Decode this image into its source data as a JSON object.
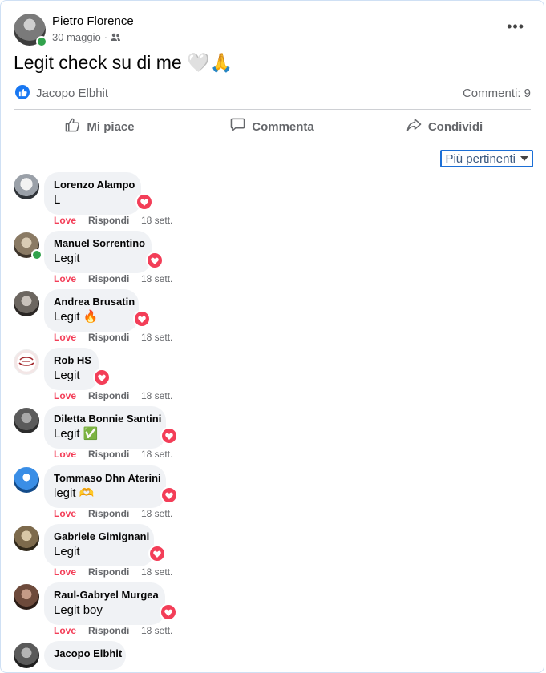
{
  "post": {
    "author": "Pietro Florence",
    "date": "30 maggio",
    "text": "Legit check su di me 🤍🙏",
    "reactor": "Jacopo Elbhit",
    "comment_count": "Commenti: 9"
  },
  "actions": {
    "like": "Mi piace",
    "comment": "Commenta",
    "share": "Condividi"
  },
  "sort": {
    "label": "Più pertinenti"
  },
  "comment_actions": {
    "love": "Love",
    "reply": "Rispondi"
  },
  "comments": [
    {
      "name": "Lorenzo Alampo",
      "text": "L",
      "time": "18 sett."
    },
    {
      "name": "Manuel Sorrentino",
      "text": "Legit",
      "time": "18 sett."
    },
    {
      "name": "Andrea Brusatin",
      "text": "Legit 🔥",
      "time": "18 sett."
    },
    {
      "name": "Rob HS",
      "text": "Legit",
      "time": "18 sett."
    },
    {
      "name": "Diletta Bonnie Santini",
      "text": "Legit ✅",
      "time": "18 sett."
    },
    {
      "name": "Tommaso Dhn Aterini",
      "text": "legit 🫶",
      "time": "18 sett."
    },
    {
      "name": "Gabriele Gimignani",
      "text": "Legit",
      "time": "18 sett."
    },
    {
      "name": "Raul-Gabryel Murgea",
      "text": "Legit boy",
      "time": "18 sett."
    },
    {
      "name": "Jacopo Elbhit",
      "text": "",
      "time": ""
    }
  ],
  "colors": {
    "accent": "#1877f2",
    "love": "#f33e58",
    "bubble": "#f0f2f5",
    "secondary_text": "#65676b"
  }
}
